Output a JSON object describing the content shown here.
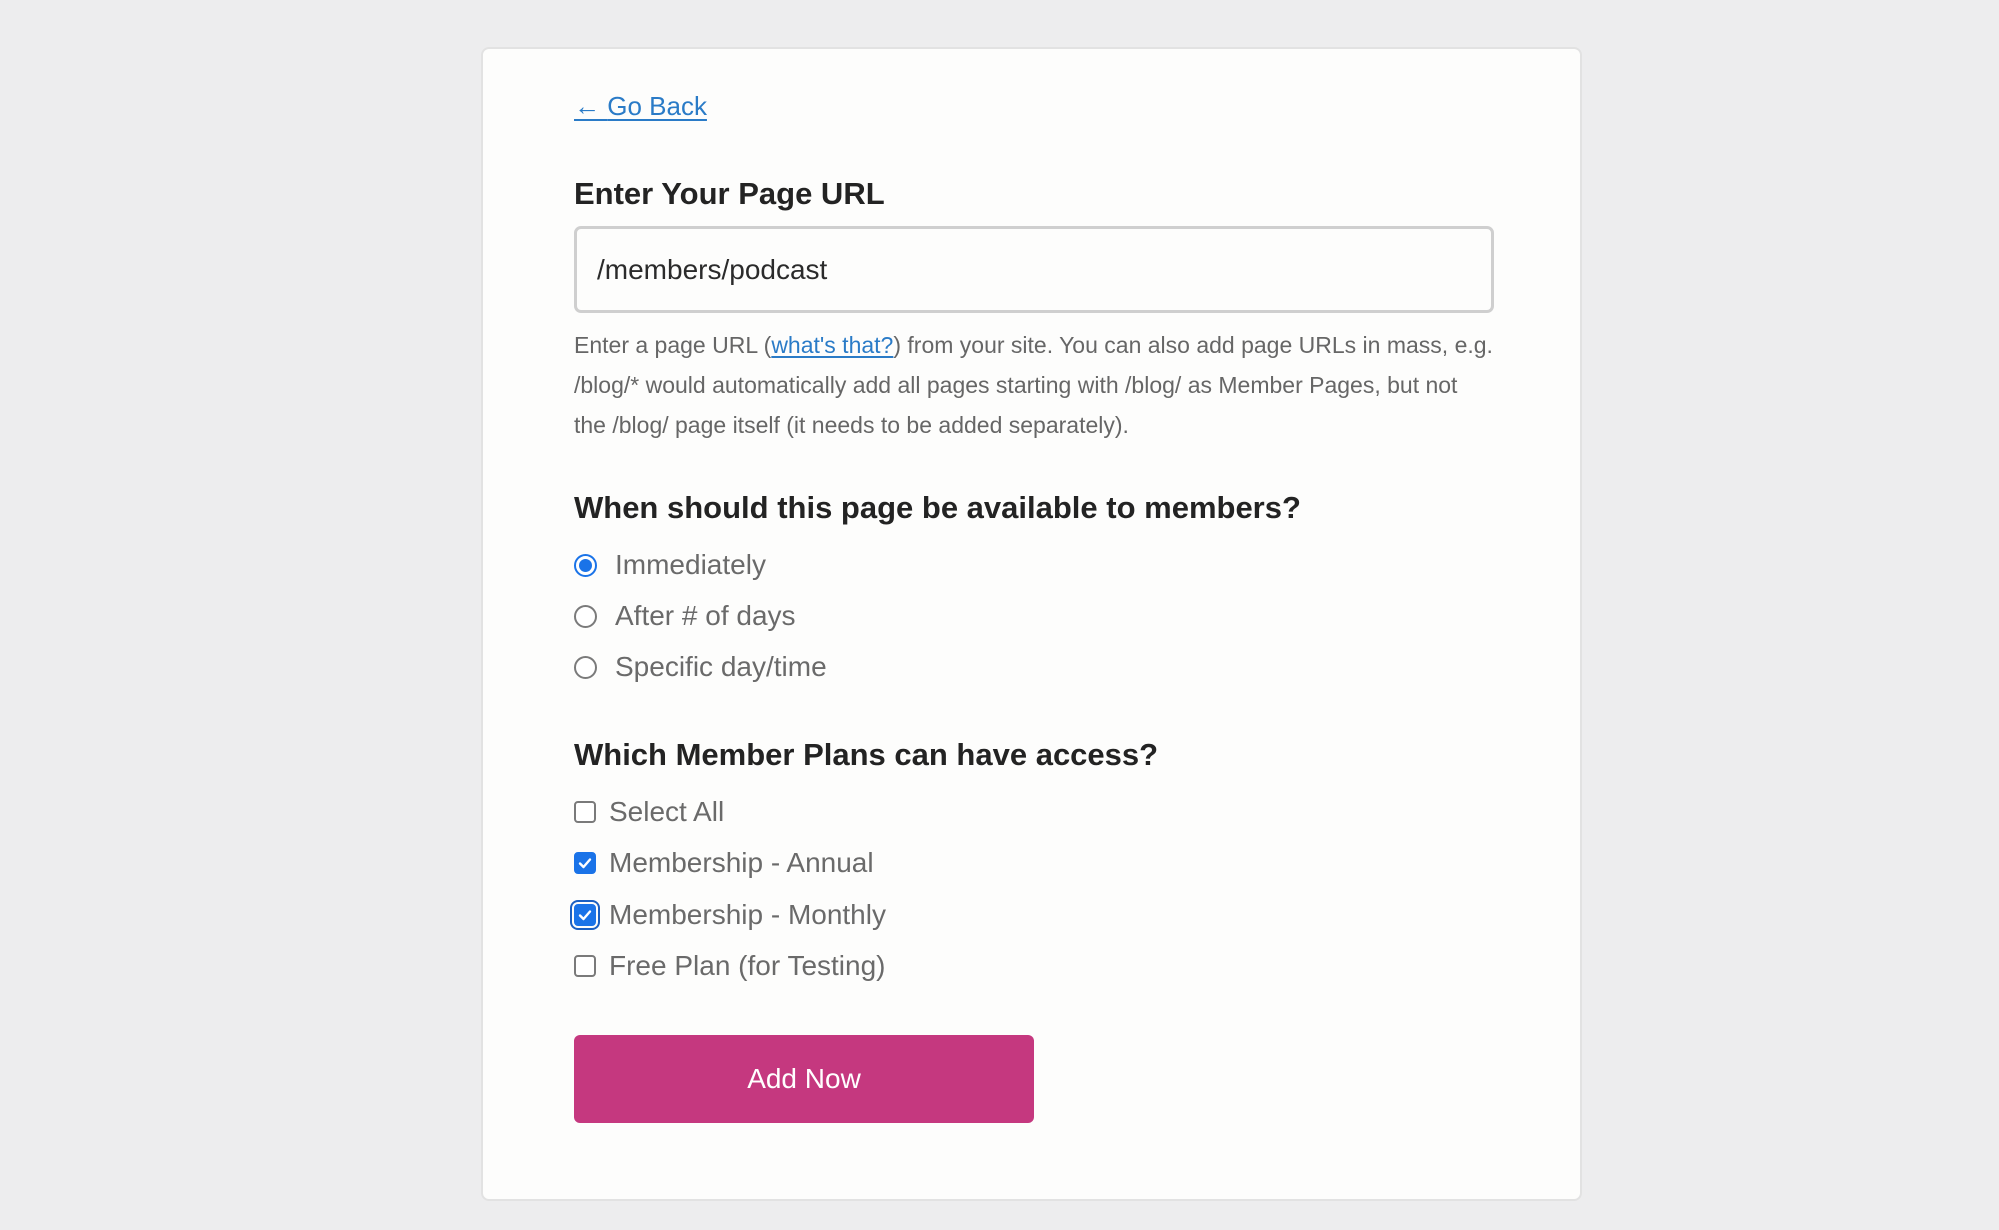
{
  "nav": {
    "back_arrow": "←",
    "back_label": "Go Back"
  },
  "url_section": {
    "heading": "Enter Your Page URL",
    "input_value": "/members/podcast",
    "help_before": "Enter a page URL (",
    "help_link": "what's that?",
    "help_after": ") from your site. You can also add page URLs in mass, e.g. /blog/* would automatically add all pages starting with /blog/ as Member Pages, but not the /blog/ page itself (it needs to be added separately)."
  },
  "availability": {
    "heading": "When should this page be available to members?",
    "options": [
      {
        "label": "Immediately",
        "selected": true
      },
      {
        "label": "After # of days",
        "selected": false
      },
      {
        "label": "Specific day/time",
        "selected": false
      }
    ]
  },
  "plans": {
    "heading": "Which Member Plans can have access?",
    "options": [
      {
        "label": "Select All",
        "checked": false
      },
      {
        "label": "Membership - Annual",
        "checked": true
      },
      {
        "label": "Membership - Monthly",
        "checked": true,
        "focused": true
      },
      {
        "label": "Free Plan (for Testing)",
        "checked": false
      }
    ]
  },
  "actions": {
    "submit_label": "Add Now"
  },
  "colors": {
    "accent_blue": "#1a73e8",
    "link_blue": "#2a7bc7",
    "button_pink": "#c5387f"
  }
}
